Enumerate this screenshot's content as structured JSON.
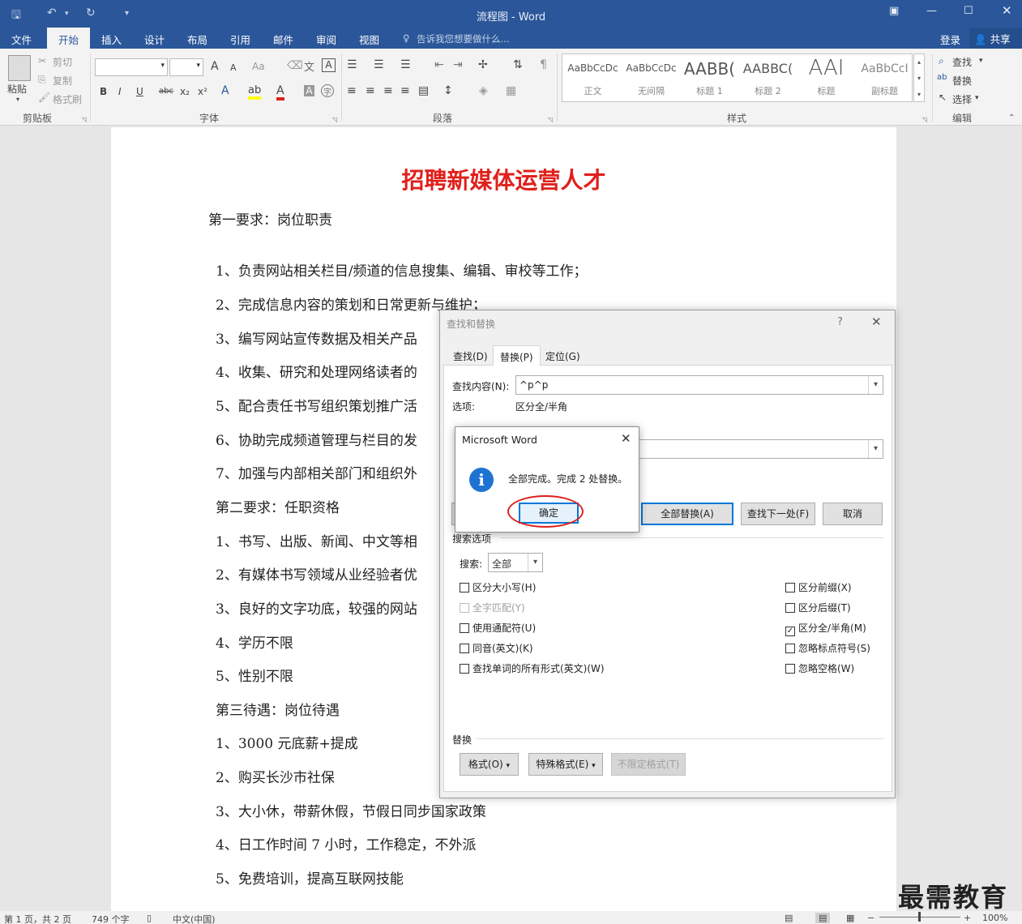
{
  "app": {
    "title": "流程图 - Word"
  },
  "menu_tabs": {
    "file": "文件",
    "home": "开始",
    "insert": "插入",
    "design": "设计",
    "layout": "布局",
    "references": "引用",
    "mailings": "邮件",
    "review": "审阅",
    "view": "视图",
    "tell_me": "告诉我您想要做什么...",
    "login": "登录",
    "share": "共享"
  },
  "ribbon": {
    "clipboard": {
      "paste": "粘贴",
      "cut": "剪切",
      "copy": "复制",
      "format_painter": "格式刷",
      "label": "剪贴板"
    },
    "font": {
      "label": "字体",
      "bold": "B",
      "italic": "I",
      "underline": "U",
      "strike": "abc",
      "sub": "x₂",
      "sup": "x²",
      "grow": "A",
      "shrink": "A",
      "case": "Aa"
    },
    "paragraph": {
      "label": "段落"
    },
    "styles": {
      "label": "样式",
      "items": [
        {
          "sample": "AaBbCcDc",
          "name": "正文"
        },
        {
          "sample": "AaBbCcDc",
          "name": "无间隔"
        },
        {
          "sample": "AABB(",
          "name": "标题 1"
        },
        {
          "sample": "AABBC(",
          "name": "标题 2"
        },
        {
          "sample": "AAI",
          "name": "标题"
        },
        {
          "sample": "AaBbCcI",
          "name": "副标题"
        }
      ]
    },
    "editing": {
      "label": "编辑",
      "find": "查找",
      "replace": "替换",
      "select": "选择"
    }
  },
  "document": {
    "title": "招聘新媒体运营人才",
    "lines": [
      "第一要求：岗位职责",
      "1、负责网站相关栏目/频道的信息搜集、编辑、审校等工作；",
      "2、完成信息内容的策划和日常更新与维护；",
      "3、编写网站宣传数据及相关产品",
      "4、收集、研究和处理网络读者的",
      "5、配合责任书写组织策划推广活",
      "6、协助完成频道管理与栏目的发",
      "7、加强与内部相关部门和组织外",
      "第二要求：任职资格",
      "1、书写、出版、新闻、中文等相",
      "2、有媒体书写领域从业经验者优",
      "3、良好的文字功底，较强的网站",
      "4、学历不限",
      "5、性别不限",
      "第三待遇：岗位待遇",
      "1、3000 元底薪+提成",
      "2、购买长沙市社保",
      "3、大小休，带薪休假，节假日同步国家政策",
      "4、日工作时间 7 小时，工作稳定，不外派",
      "5、免费培训，提高互联网技能"
    ]
  },
  "dialog": {
    "title": "查找和替换",
    "help": "?",
    "tabs": [
      "查找(D)",
      "替换(P)",
      "定位(G)"
    ],
    "find_label": "查找内容(N):",
    "find_value": "^p^p",
    "options_label": "选项:",
    "options_value": "区分全/半角",
    "replace_all": "全部替换(A)",
    "find_next": "查找下一处(F)",
    "cancel": "取消",
    "search_options_label": "搜索选项",
    "search_label": "搜索:",
    "search_value": "全部",
    "checkboxes_left": [
      {
        "label": "区分大小写(H)",
        "checked": false,
        "disabled": false
      },
      {
        "label": "全字匹配(Y)",
        "checked": false,
        "disabled": true
      },
      {
        "label": "使用通配符(U)",
        "checked": false,
        "disabled": false
      },
      {
        "label": "同音(英文)(K)",
        "checked": false,
        "disabled": false
      },
      {
        "label": "查找单词的所有形式(英文)(W)",
        "checked": false,
        "disabled": false
      }
    ],
    "checkboxes_right": [
      {
        "label": "区分前缀(X)",
        "checked": false
      },
      {
        "label": "区分后缀(T)",
        "checked": false
      },
      {
        "label": "区分全/半角(M)",
        "checked": true
      },
      {
        "label": "忽略标点符号(S)",
        "checked": false
      },
      {
        "label": "忽略空格(W)",
        "checked": false
      }
    ],
    "replace_section_label": "替换",
    "format_btn": "格式(O)",
    "special_btn": "特殊格式(E)",
    "no_format_btn": "不限定格式(T)"
  },
  "msgbox": {
    "title": "Microsoft Word",
    "message": "全部完成。完成 2 处替换。",
    "ok": "确定"
  },
  "status": {
    "page": "第 1 页，共 2 页",
    "words": "749 个字",
    "lang": "中文(中国)",
    "zoom": "100%"
  },
  "watermark": "最需教育"
}
